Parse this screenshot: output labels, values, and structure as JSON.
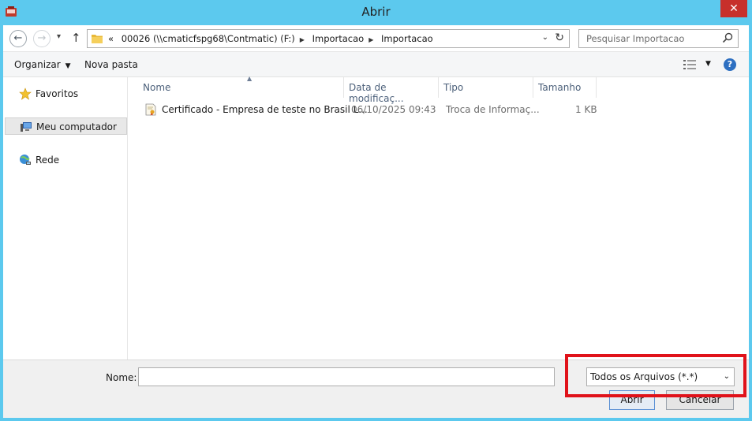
{
  "window": {
    "title": "Abrir",
    "close_glyph": "✕",
    "icon": "app-icon"
  },
  "nav": {
    "back_glyph": "←",
    "forward_glyph": "→",
    "recent_glyph": "▾",
    "up_glyph": "↑",
    "path_prefix": "«",
    "breadcrumbs": [
      "00026 (\\\\cmaticfspg68\\Contmatic) (F:)",
      "Importacao",
      "Importacao"
    ],
    "crumb_separator": "▶",
    "dropdown_glyph": "⌄",
    "refresh_glyph": "↻",
    "search_placeholder": "Pesquisar Importacao"
  },
  "toolbar": {
    "organize_label": "Organizar",
    "organize_caret": "▼",
    "new_folder_label": "Nova pasta",
    "view_caret": "▼",
    "help_glyph": "?"
  },
  "sidebar": {
    "items": [
      {
        "label": "Favoritos",
        "icon": "star-icon",
        "selected": false
      },
      {
        "label": "Meu computador",
        "icon": "computer-icon",
        "selected": true
      },
      {
        "label": "Rede",
        "icon": "network-icon",
        "selected": false
      }
    ]
  },
  "files": {
    "sort_glyph": "▲",
    "columns": [
      "Nome",
      "Data de modificaç...",
      "Tipo",
      "Tamanho"
    ],
    "rows": [
      {
        "name": "Certificado - Empresa de teste no Brasil L...",
        "modified": "06/10/2025 09:43",
        "type": "Troca de Informaç...",
        "size": "1 KB",
        "icon": "certificate-file-icon"
      }
    ]
  },
  "footer": {
    "name_label": "Nome:",
    "name_value": "",
    "filter_value": "Todos os Arquivos (*.*)",
    "filter_caret": "⌄",
    "open_label": "Abrir",
    "cancel_label": "Cancelar"
  },
  "colors": {
    "titlebar": "#5cc9ee",
    "close": "#c7302b",
    "highlight": "#e0121a",
    "header_text": "#4c607a"
  }
}
